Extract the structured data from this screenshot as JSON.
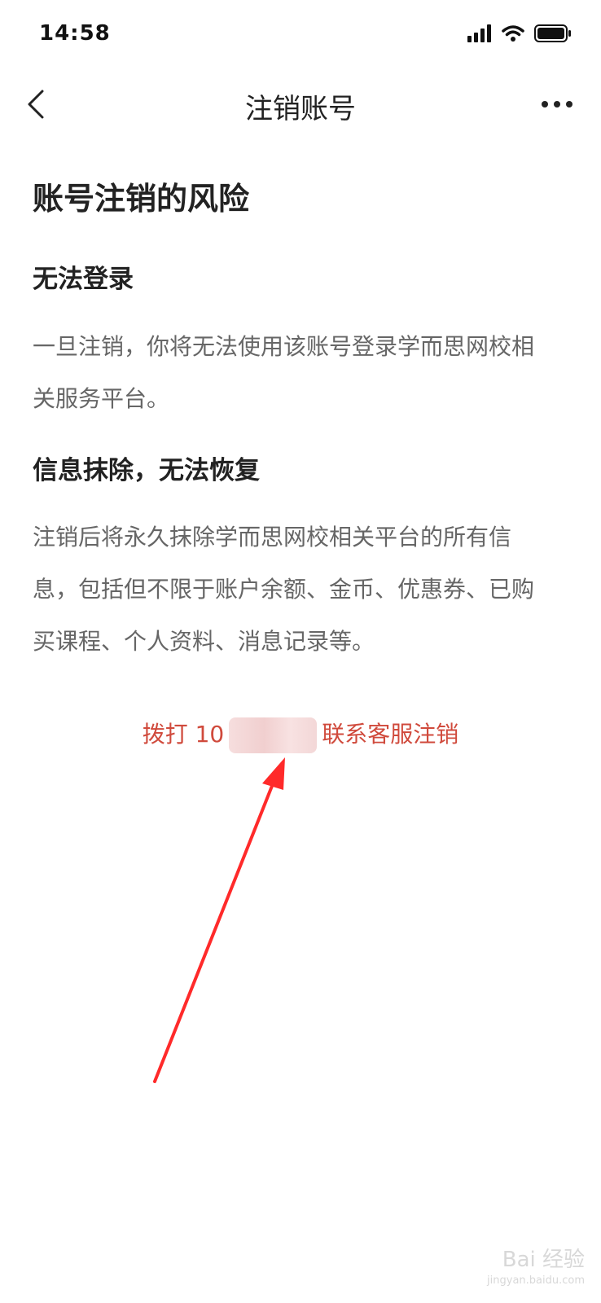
{
  "status_bar": {
    "time": "14:58",
    "icons": [
      "signal-icon",
      "wifi-icon",
      "battery-icon"
    ]
  },
  "nav": {
    "title": "注销账号",
    "back_icon": "chevron-left-icon",
    "more_icon": "more-dots-icon"
  },
  "content": {
    "risk_title": "账号注销的风险",
    "sections": [
      {
        "title": "无法登录",
        "body": "一旦注销，你将无法使用该账号登录学而思网校相关服务平台。"
      },
      {
        "title": "信息抹除，无法恢复",
        "body": "注销后将永久抹除学而思网校相关平台的所有信息，包括但不限于账户余额、金币、优惠券、已购买课程、个人资料、消息记录等。"
      }
    ]
  },
  "contact": {
    "prefix": "拨打 10",
    "suffix": "联系客服注销",
    "color": "#d04a3c"
  },
  "annotation": {
    "arrow_color": "#ff2a2a"
  },
  "watermark": {
    "text": "Bai 经验",
    "subtext": "jingyan.baidu.com"
  }
}
